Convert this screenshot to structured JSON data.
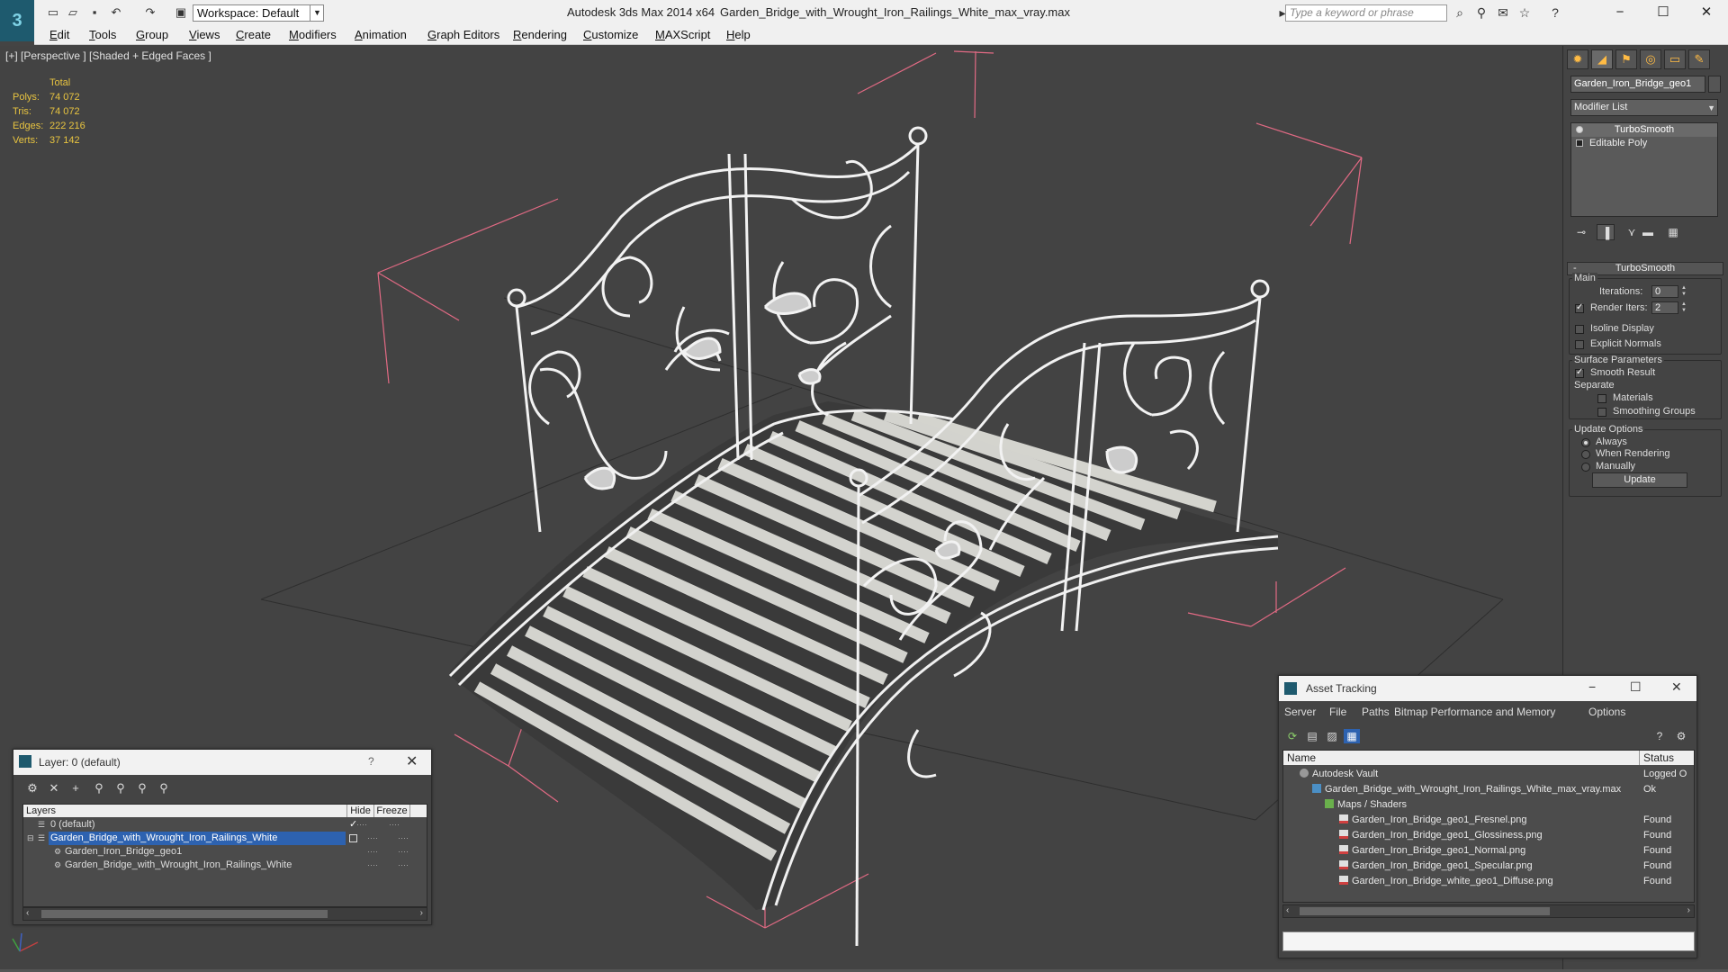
{
  "titlebar": {
    "workspace": "Workspace: Default",
    "app_title": "Autodesk 3ds Max  2014 x64",
    "file_title": "Garden_Bridge_with_Wrought_Iron_Railings_White_max_vray.max",
    "search_placeholder": "Type a keyword or phrase"
  },
  "menubar": [
    "Edit",
    "Tools",
    "Group",
    "Views",
    "Create",
    "Modifiers",
    "Animation",
    "Graph Editors",
    "Rendering",
    "Customize",
    "MAXScript",
    "Help"
  ],
  "viewport": {
    "label": "[+] [Perspective ] [Shaded + Edged Faces ]",
    "stats": {
      "header": "Total",
      "rows": [
        {
          "label": "Polys:",
          "value": "74 072"
        },
        {
          "label": "Tris:",
          "value": "74 072"
        },
        {
          "label": "Edges:",
          "value": "222 216"
        },
        {
          "label": "Verts:",
          "value": "37 142"
        }
      ]
    }
  },
  "command_panel": {
    "object_name": "Garden_Iron_Bridge_geo1",
    "modifier_list": "Modifier List",
    "stack": [
      "TurboSmooth",
      "Editable Poly"
    ],
    "rollout": "TurboSmooth",
    "main_group": "Main",
    "iterations_label": "Iterations:",
    "iterations_value": "0",
    "render_iters_label": "Render Iters:",
    "render_iters_value": "2",
    "isoline_display": "Isoline Display",
    "explicit_normals": "Explicit Normals",
    "surface_parameters": "Surface Parameters",
    "smooth_result": "Smooth Result",
    "separate": "Separate",
    "materials": "Materials",
    "smoothing_groups": "Smoothing Groups",
    "update_options": "Update Options",
    "always": "Always",
    "when_rendering": "When Rendering",
    "manually": "Manually",
    "update_button": "Update"
  },
  "layer_dialog": {
    "title": "Layer: 0 (default)",
    "help": "?",
    "columns": {
      "layers": "Layers",
      "hide": "Hide",
      "freeze": "Freeze"
    },
    "rows": [
      {
        "name": "0 (default)",
        "indent": 1
      },
      {
        "name": "Garden_Bridge_with_Wrought_Iron_Railings_White",
        "indent": 1
      },
      {
        "name": "Garden_Iron_Bridge_geo1",
        "indent": 2
      },
      {
        "name": "Garden_Bridge_with_Wrought_Iron_Railings_White",
        "indent": 2
      }
    ]
  },
  "asset_tracking": {
    "title": "Asset Tracking",
    "menu": [
      "Server",
      "File",
      "Paths",
      "Bitmap Performance and Memory",
      "Options"
    ],
    "columns": {
      "name": "Name",
      "status": "Status"
    },
    "rows": [
      {
        "name": "Autodesk Vault",
        "status": "Logged O"
      },
      {
        "name": "Garden_Bridge_with_Wrought_Iron_Railings_White_max_vray.max",
        "status": "Ok"
      },
      {
        "name": "Maps / Shaders",
        "status": ""
      },
      {
        "name": "Garden_Iron_Bridge_geo1_Fresnel.png",
        "status": "Found"
      },
      {
        "name": "Garden_Iron_Bridge_geo1_Glossiness.png",
        "status": "Found"
      },
      {
        "name": "Garden_Iron_Bridge_geo1_Normal.png",
        "status": "Found"
      },
      {
        "name": "Garden_Iron_Bridge_geo1_Specular.png",
        "status": "Found"
      },
      {
        "name": "Garden_Iron_Bridge_white_geo1_Diffuse.png",
        "status": "Found"
      }
    ]
  },
  "colors": {
    "viewport_bg": "#434343",
    "stats": "#e8c440",
    "selection": "#2d62b0",
    "bbox": "#e26a84",
    "wire": "#eeeeee"
  }
}
